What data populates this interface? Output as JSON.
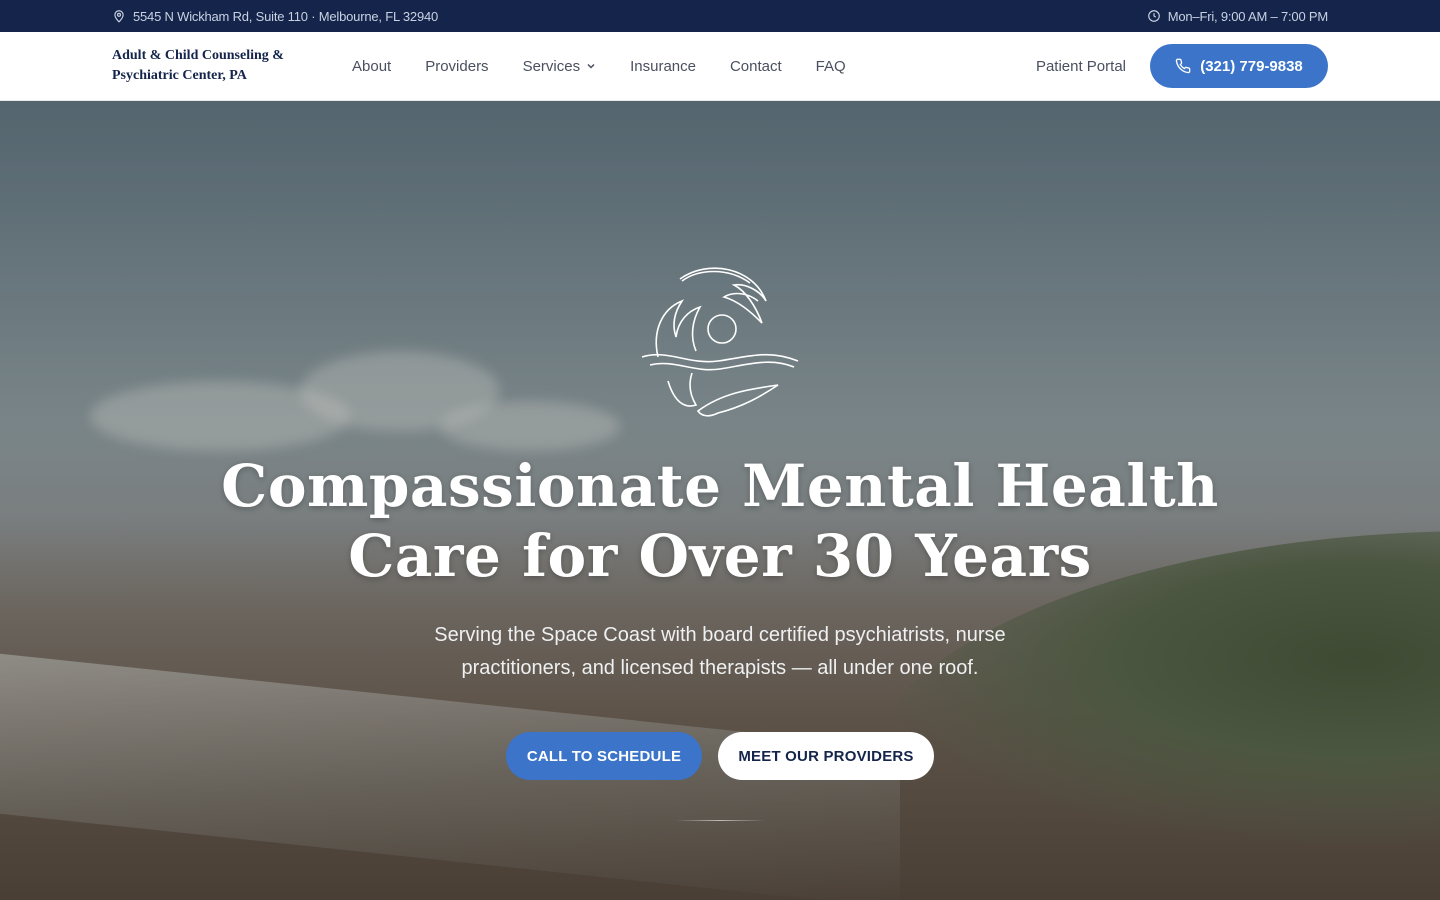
{
  "topbar": {
    "address": "5545 N Wickham Rd, Suite 110 · Melbourne, FL 32940",
    "hours": "Mon–Fri, 9:00 AM – 7:00 PM"
  },
  "navbar": {
    "brand_line1": "Adult & Child Counseling &",
    "brand_line2": "Psychiatric Center, PA",
    "links": [
      "About",
      "Providers",
      "Services",
      "Insurance",
      "Contact",
      "FAQ"
    ],
    "portal": "Patient Portal",
    "phone": "(321) 779-9838"
  },
  "hero": {
    "title_line1": "Compassionate Mental Health",
    "title_line2": "Care for Over 30 Years",
    "subtitle": "Serving the Space Coast with board certified psychiatrists, nurse practitioners, and licensed therapists — all under one roof.",
    "primary_button": "CALL TO SCHEDULE",
    "secondary_button": "MEET OUR PROVIDERS"
  },
  "colors": {
    "topbar_bg": "#14244a",
    "accent_blue": "#3b74c9",
    "brand_navy": "#14244a"
  },
  "icons": [
    "map-pin-icon",
    "clock-icon",
    "chevron-down-icon",
    "phone-icon",
    "dolphins-logo-icon"
  ]
}
